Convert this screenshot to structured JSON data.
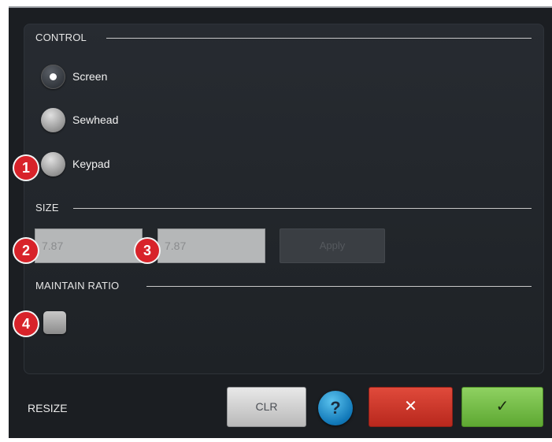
{
  "sections": {
    "control": "CONTROL",
    "size": "SIZE",
    "maintain_ratio": "MAINTAIN RATIO"
  },
  "control_options": [
    {
      "label": "Screen",
      "selected": true
    },
    {
      "label": "Sewhead",
      "selected": false
    },
    {
      "label": "Keypad",
      "selected": false
    }
  ],
  "size": {
    "width_value": "7.87",
    "height_value": "7.87",
    "apply_label": "Apply"
  },
  "maintain_ratio_checked": false,
  "markers": [
    "1",
    "2",
    "3",
    "4"
  ],
  "footer": {
    "title": "RESIZE",
    "clr_label": "CLR",
    "help_glyph": "?",
    "cancel_glyph": "✕",
    "ok_glyph": "✓"
  },
  "colors": {
    "background": "#1b1e22",
    "marker": "#d8232a",
    "cancel": "#c9352a",
    "ok": "#7cc24b",
    "help": "#1c8ccc"
  }
}
